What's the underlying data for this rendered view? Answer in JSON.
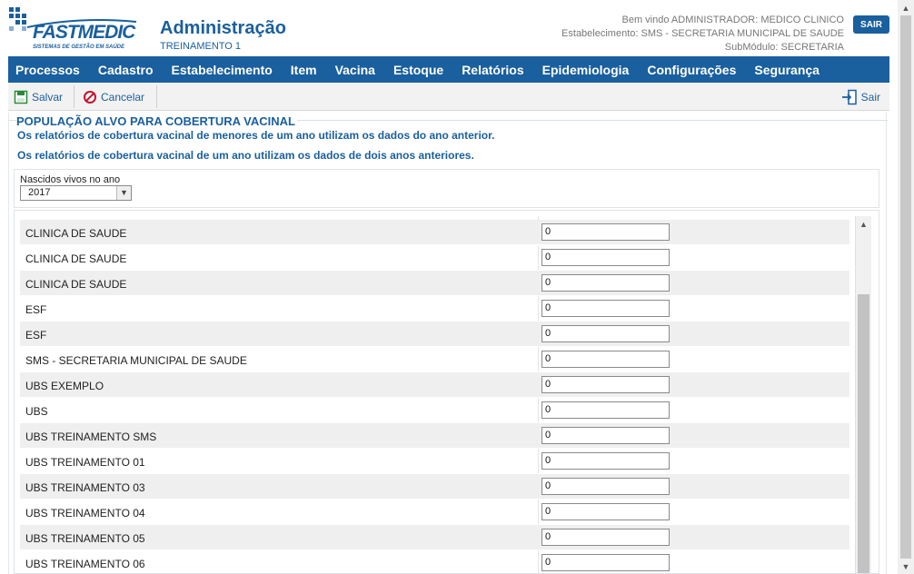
{
  "header": {
    "logo_text": "FASTMEDIC",
    "logo_tagline": "SISTEMAS DE GESTÃO EM SAÚDE",
    "title": "Administração",
    "subtitle": "TREINAMENTO 1",
    "welcome": "Bem vindo ADMINISTRADOR: MEDICO CLINICO",
    "establishment": "Estabelecimento: SMS - SECRETARIA MUNICIPAL DE SAUDE",
    "submodule": "SubMódulo: SECRETARIA",
    "logout_label": "SAIR"
  },
  "nav": {
    "items": [
      "Processos",
      "Cadastro",
      "Estabelecimento",
      "Item",
      "Vacina",
      "Estoque",
      "Relatórios",
      "Epidemiologia",
      "Configurações",
      "Segurança"
    ]
  },
  "toolbar": {
    "save_label": "Salvar",
    "cancel_label": "Cancelar",
    "exit_label": "Sair"
  },
  "content": {
    "section_title": "POPULAÇÃO ALVO PARA COBERTURA VACINAL",
    "info_1": "Os relatórios de cobertura vacinal de menores de um ano utilizam os dados do ano anterior.",
    "info_2": "Os relatórios de cobertura vacinal de um ano utilizam os dados de dois anos anteriores.",
    "filter_label": "Nascidos vivos no ano",
    "selected_year": "2017"
  },
  "rows": [
    {
      "name": "CLINICA DE SAUDE",
      "value": "0"
    },
    {
      "name": "CLINICA DE SAUDE",
      "value": "0"
    },
    {
      "name": "CLINICA DE SAUDE",
      "value": "0"
    },
    {
      "name": "ESF",
      "value": "0"
    },
    {
      "name": "ESF",
      "value": "0"
    },
    {
      "name": "SMS - SECRETARIA MUNICIPAL DE SAUDE",
      "value": "0"
    },
    {
      "name": "UBS EXEMPLO",
      "value": "0"
    },
    {
      "name": "UBS",
      "value": "0"
    },
    {
      "name": "UBS TREINAMENTO SMS",
      "value": "0"
    },
    {
      "name": "UBS TREINAMENTO 01",
      "value": "0"
    },
    {
      "name": "UBS TREINAMENTO 03",
      "value": "0"
    },
    {
      "name": "UBS TREINAMENTO 04",
      "value": "0"
    },
    {
      "name": "UBS TREINAMENTO 05",
      "value": "0"
    },
    {
      "name": "UBS TREINAMENTO 06",
      "value": "0"
    }
  ],
  "colors": {
    "brand": "#1a5f9e",
    "row_alt": "#efefef"
  }
}
